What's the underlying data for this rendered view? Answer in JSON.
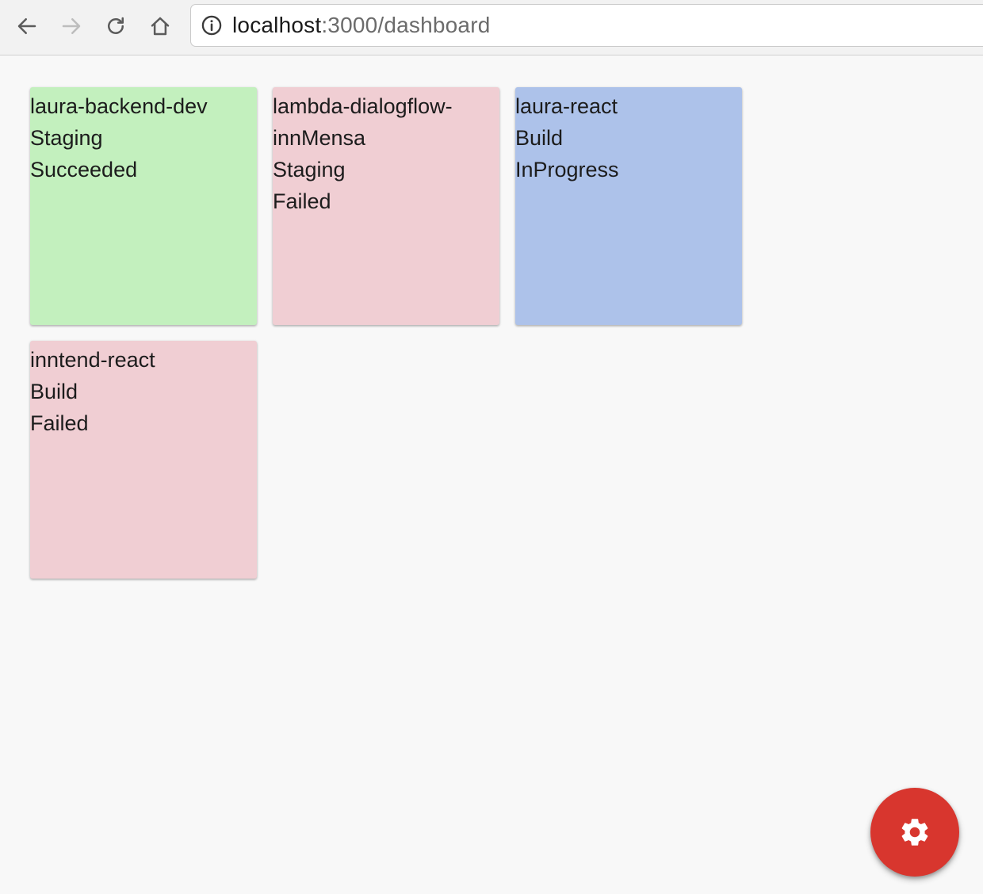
{
  "browser": {
    "url_host": "localhost",
    "url_rest": ":3000/dashboard",
    "icons": {
      "back": "arrow-left-icon",
      "forward": "arrow-right-icon",
      "reload": "reload-icon",
      "home": "home-icon",
      "info": "info-circle-icon"
    }
  },
  "colors": {
    "succeeded": "#c3f0be",
    "failed": "#f0ced3",
    "in_progress": "#adc2ea",
    "fab": "#d8362e"
  },
  "cards": [
    {
      "project": "laura-backend-dev",
      "stage": "Staging",
      "status": "Succeeded"
    },
    {
      "project": "lambda-dialogflow-innMensa",
      "stage": "Staging",
      "status": "Failed"
    },
    {
      "project": "laura-react",
      "stage": "Build",
      "status": "InProgress"
    },
    {
      "project": "inntend-react",
      "stage": "Build",
      "status": "Failed"
    }
  ],
  "fab": {
    "icon": "gear-icon"
  }
}
